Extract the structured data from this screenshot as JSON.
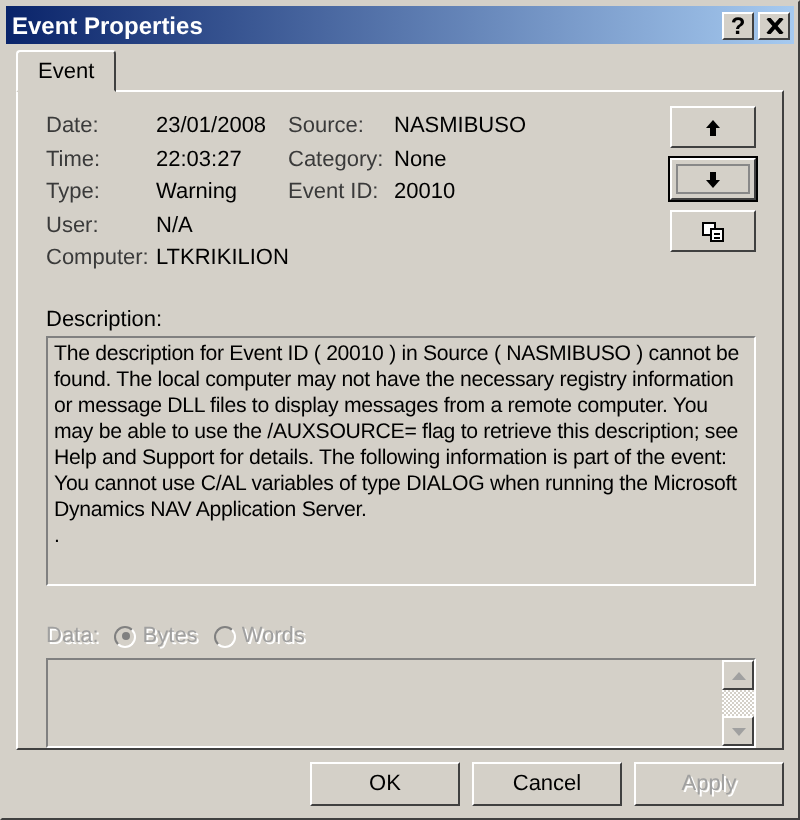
{
  "window": {
    "title": "Event Properties",
    "help": "?"
  },
  "tabs": [
    {
      "label": "Event",
      "selected": true
    }
  ],
  "fields_left": [
    {
      "label": "Date:",
      "value": "23/01/2008"
    },
    {
      "label": "Time:",
      "value": "22:03:27"
    },
    {
      "label": "Type:",
      "value": "Warning"
    },
    {
      "label": "User:",
      "value": "N/A"
    },
    {
      "label": "Computer:",
      "value": "LTKRIKILION"
    }
  ],
  "fields_right": [
    {
      "label": "Source:",
      "value": "NASMIBUSO"
    },
    {
      "label": "Category:",
      "value": "None"
    },
    {
      "label": "Event ID:",
      "value": "20010"
    }
  ],
  "side_buttons": [
    {
      "kind": "up",
      "focused": false
    },
    {
      "kind": "down",
      "focused": true
    },
    {
      "kind": "copy",
      "focused": false
    }
  ],
  "description": {
    "label": "Description:",
    "text": "The description for Event ID ( 20010 ) in Source ( NASMIBUSO ) cannot be found. The local computer may not have the necessary registry information or message DLL files to display messages from a remote computer. You may be able to use the /AUXSOURCE= flag to retrieve this description; see Help and Support for details. The following information is part of the event: You cannot use C/AL variables of type DIALOG when running the Microsoft Dynamics NAV Application Server.\n."
  },
  "data": {
    "label": "Data:",
    "disabled": true,
    "options": [
      {
        "label": "Bytes",
        "selected": true
      },
      {
        "label": "Words",
        "selected": false
      }
    ]
  },
  "buttons": [
    {
      "label": "OK",
      "disabled": false
    },
    {
      "label": "Cancel",
      "disabled": false
    },
    {
      "label": "Apply",
      "disabled": true
    }
  ]
}
